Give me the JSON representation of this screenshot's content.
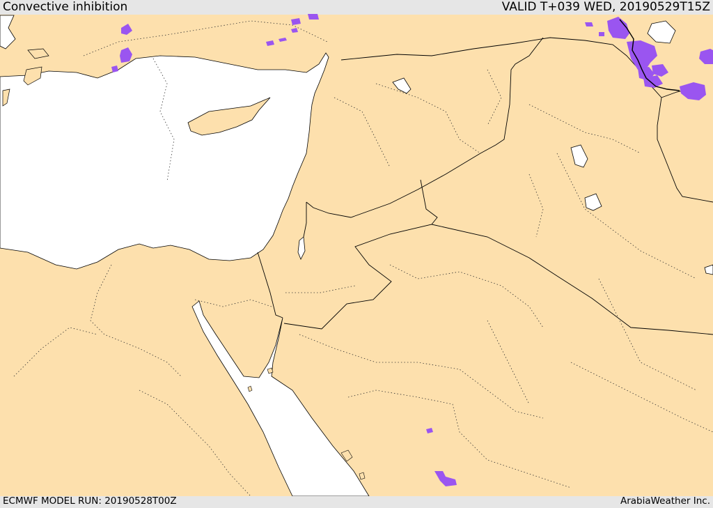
{
  "header": {
    "title": "Convective inhibition",
    "valid_time": "VALID T+039 WED, 20190529T15Z"
  },
  "footer": {
    "model_run": "ECMWF MODEL RUN: 20190528T00Z",
    "credit": "ArabiaWeather Inc."
  },
  "colors": {
    "land": "#fde0ad",
    "water": "#ffffff",
    "bar_background": "#e6e6e6",
    "field_purple": "#9a55f0",
    "field_purple_dark": "#7a3ad6",
    "border_line": "#000000"
  }
}
